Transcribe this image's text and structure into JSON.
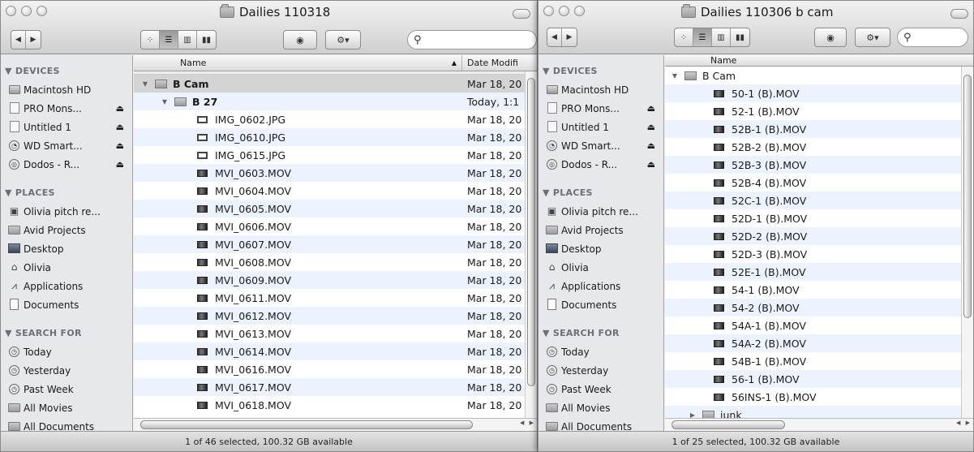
{
  "left": {
    "title": "Dailies 110318",
    "search_placeholder": "",
    "sidebar": {
      "devices_header": "▼ DEVICES",
      "devices": [
        {
          "label": "Macintosh HD",
          "eject": ""
        },
        {
          "label": "PRO Mons...",
          "eject": "⏏"
        },
        {
          "label": "Untitled 1",
          "eject": "⏏"
        },
        {
          "label": "WD Smart...",
          "eject": "⏏"
        },
        {
          "label": "Dodos - R...",
          "eject": "⏏"
        }
      ],
      "places_header": "▼ PLACES",
      "places": [
        {
          "label": "Olivia pitch re..."
        },
        {
          "label": "Avid Projects"
        },
        {
          "label": "Desktop"
        },
        {
          "label": "Olivia"
        },
        {
          "label": "Applications"
        },
        {
          "label": "Documents"
        }
      ],
      "search_header": "▼ SEARCH FOR",
      "search": [
        {
          "label": "Today"
        },
        {
          "label": "Yesterday"
        },
        {
          "label": "Past Week"
        },
        {
          "label": "All Movies"
        },
        {
          "label": "All Documents"
        }
      ]
    },
    "columns": {
      "name": "Name",
      "date": "Date Modifi"
    },
    "rows": [
      {
        "name": "B Cam",
        "date": "Mar 18, 20"
      },
      {
        "name": "B 27",
        "date": "Today, 1:1"
      },
      {
        "name": "IMG_0602.JPG",
        "date": "Mar 18, 20"
      },
      {
        "name": "IMG_0610.JPG",
        "date": "Mar 18, 20"
      },
      {
        "name": "IMG_0615.JPG",
        "date": "Mar 18, 20"
      },
      {
        "name": "MVI_0603.MOV",
        "date": "Mar 18, 20"
      },
      {
        "name": "MVI_0604.MOV",
        "date": "Mar 18, 20"
      },
      {
        "name": "MVI_0605.MOV",
        "date": "Mar 18, 20"
      },
      {
        "name": "MVI_0606.MOV",
        "date": "Mar 18, 20"
      },
      {
        "name": "MVI_0607.MOV",
        "date": "Mar 18, 20"
      },
      {
        "name": "MVI_0608.MOV",
        "date": "Mar 18, 20"
      },
      {
        "name": "MVI_0609.MOV",
        "date": "Mar 18, 20"
      },
      {
        "name": "MVI_0611.MOV",
        "date": "Mar 18, 20"
      },
      {
        "name": "MVI_0612.MOV",
        "date": "Mar 18, 20"
      },
      {
        "name": "MVI_0613.MOV",
        "date": "Mar 18, 20"
      },
      {
        "name": "MVI_0614.MOV",
        "date": "Mar 18, 20"
      },
      {
        "name": "MVI_0616.MOV",
        "date": "Mar 18, 20"
      },
      {
        "name": "MVI_0617.MOV",
        "date": "Mar 18, 20"
      },
      {
        "name": "MVI_0618.MOV",
        "date": "Mar 18, 20"
      }
    ],
    "status": "1 of 46 selected, 100.32 GB available"
  },
  "right": {
    "title": "Dailies 110306 b cam",
    "sidebar": {
      "devices_header": "▼ DEVICES",
      "devices": [
        {
          "label": "Macintosh HD",
          "eject": ""
        },
        {
          "label": "PRO Mons...",
          "eject": "⏏"
        },
        {
          "label": "Untitled 1",
          "eject": "⏏"
        },
        {
          "label": "WD Smart...",
          "eject": "⏏"
        },
        {
          "label": "Dodos - R...",
          "eject": "⏏"
        }
      ],
      "places_header": "▼ PLACES",
      "places": [
        {
          "label": "Olivia pitch re..."
        },
        {
          "label": "Avid Projects"
        },
        {
          "label": "Desktop"
        },
        {
          "label": "Olivia"
        },
        {
          "label": "Applications"
        },
        {
          "label": "Documents"
        }
      ],
      "search_header": "▼ SEARCH FOR",
      "search": [
        {
          "label": "Today"
        },
        {
          "label": "Yesterday"
        },
        {
          "label": "Past Week"
        },
        {
          "label": "All Movies"
        },
        {
          "label": "All Documents"
        }
      ]
    },
    "columns": {
      "name": "Name"
    },
    "rows": [
      {
        "name": "B Cam"
      },
      {
        "name": "50-1 (B).MOV"
      },
      {
        "name": "52-1 (B).MOV"
      },
      {
        "name": "52B-1 (B).MOV"
      },
      {
        "name": "52B-2 (B).MOV"
      },
      {
        "name": "52B-3 (B).MOV"
      },
      {
        "name": "52B-4 (B).MOV"
      },
      {
        "name": "52C-1 (B).MOV"
      },
      {
        "name": "52D-1 (B).MOV"
      },
      {
        "name": "52D-2 (B).MOV"
      },
      {
        "name": "52D-3 (B).MOV"
      },
      {
        "name": "52E-1 (B).MOV"
      },
      {
        "name": "54-1 (B).MOV"
      },
      {
        "name": "54-2 (B).MOV"
      },
      {
        "name": "54A-1 (B).MOV"
      },
      {
        "name": "54A-2 (B).MOV"
      },
      {
        "name": "54B-1 (B).MOV"
      },
      {
        "name": "56-1 (B).MOV"
      },
      {
        "name": "56INS-1 (B).MOV"
      },
      {
        "name": "junk"
      }
    ],
    "status": "1 of 25 selected, 100.32 GB available"
  }
}
